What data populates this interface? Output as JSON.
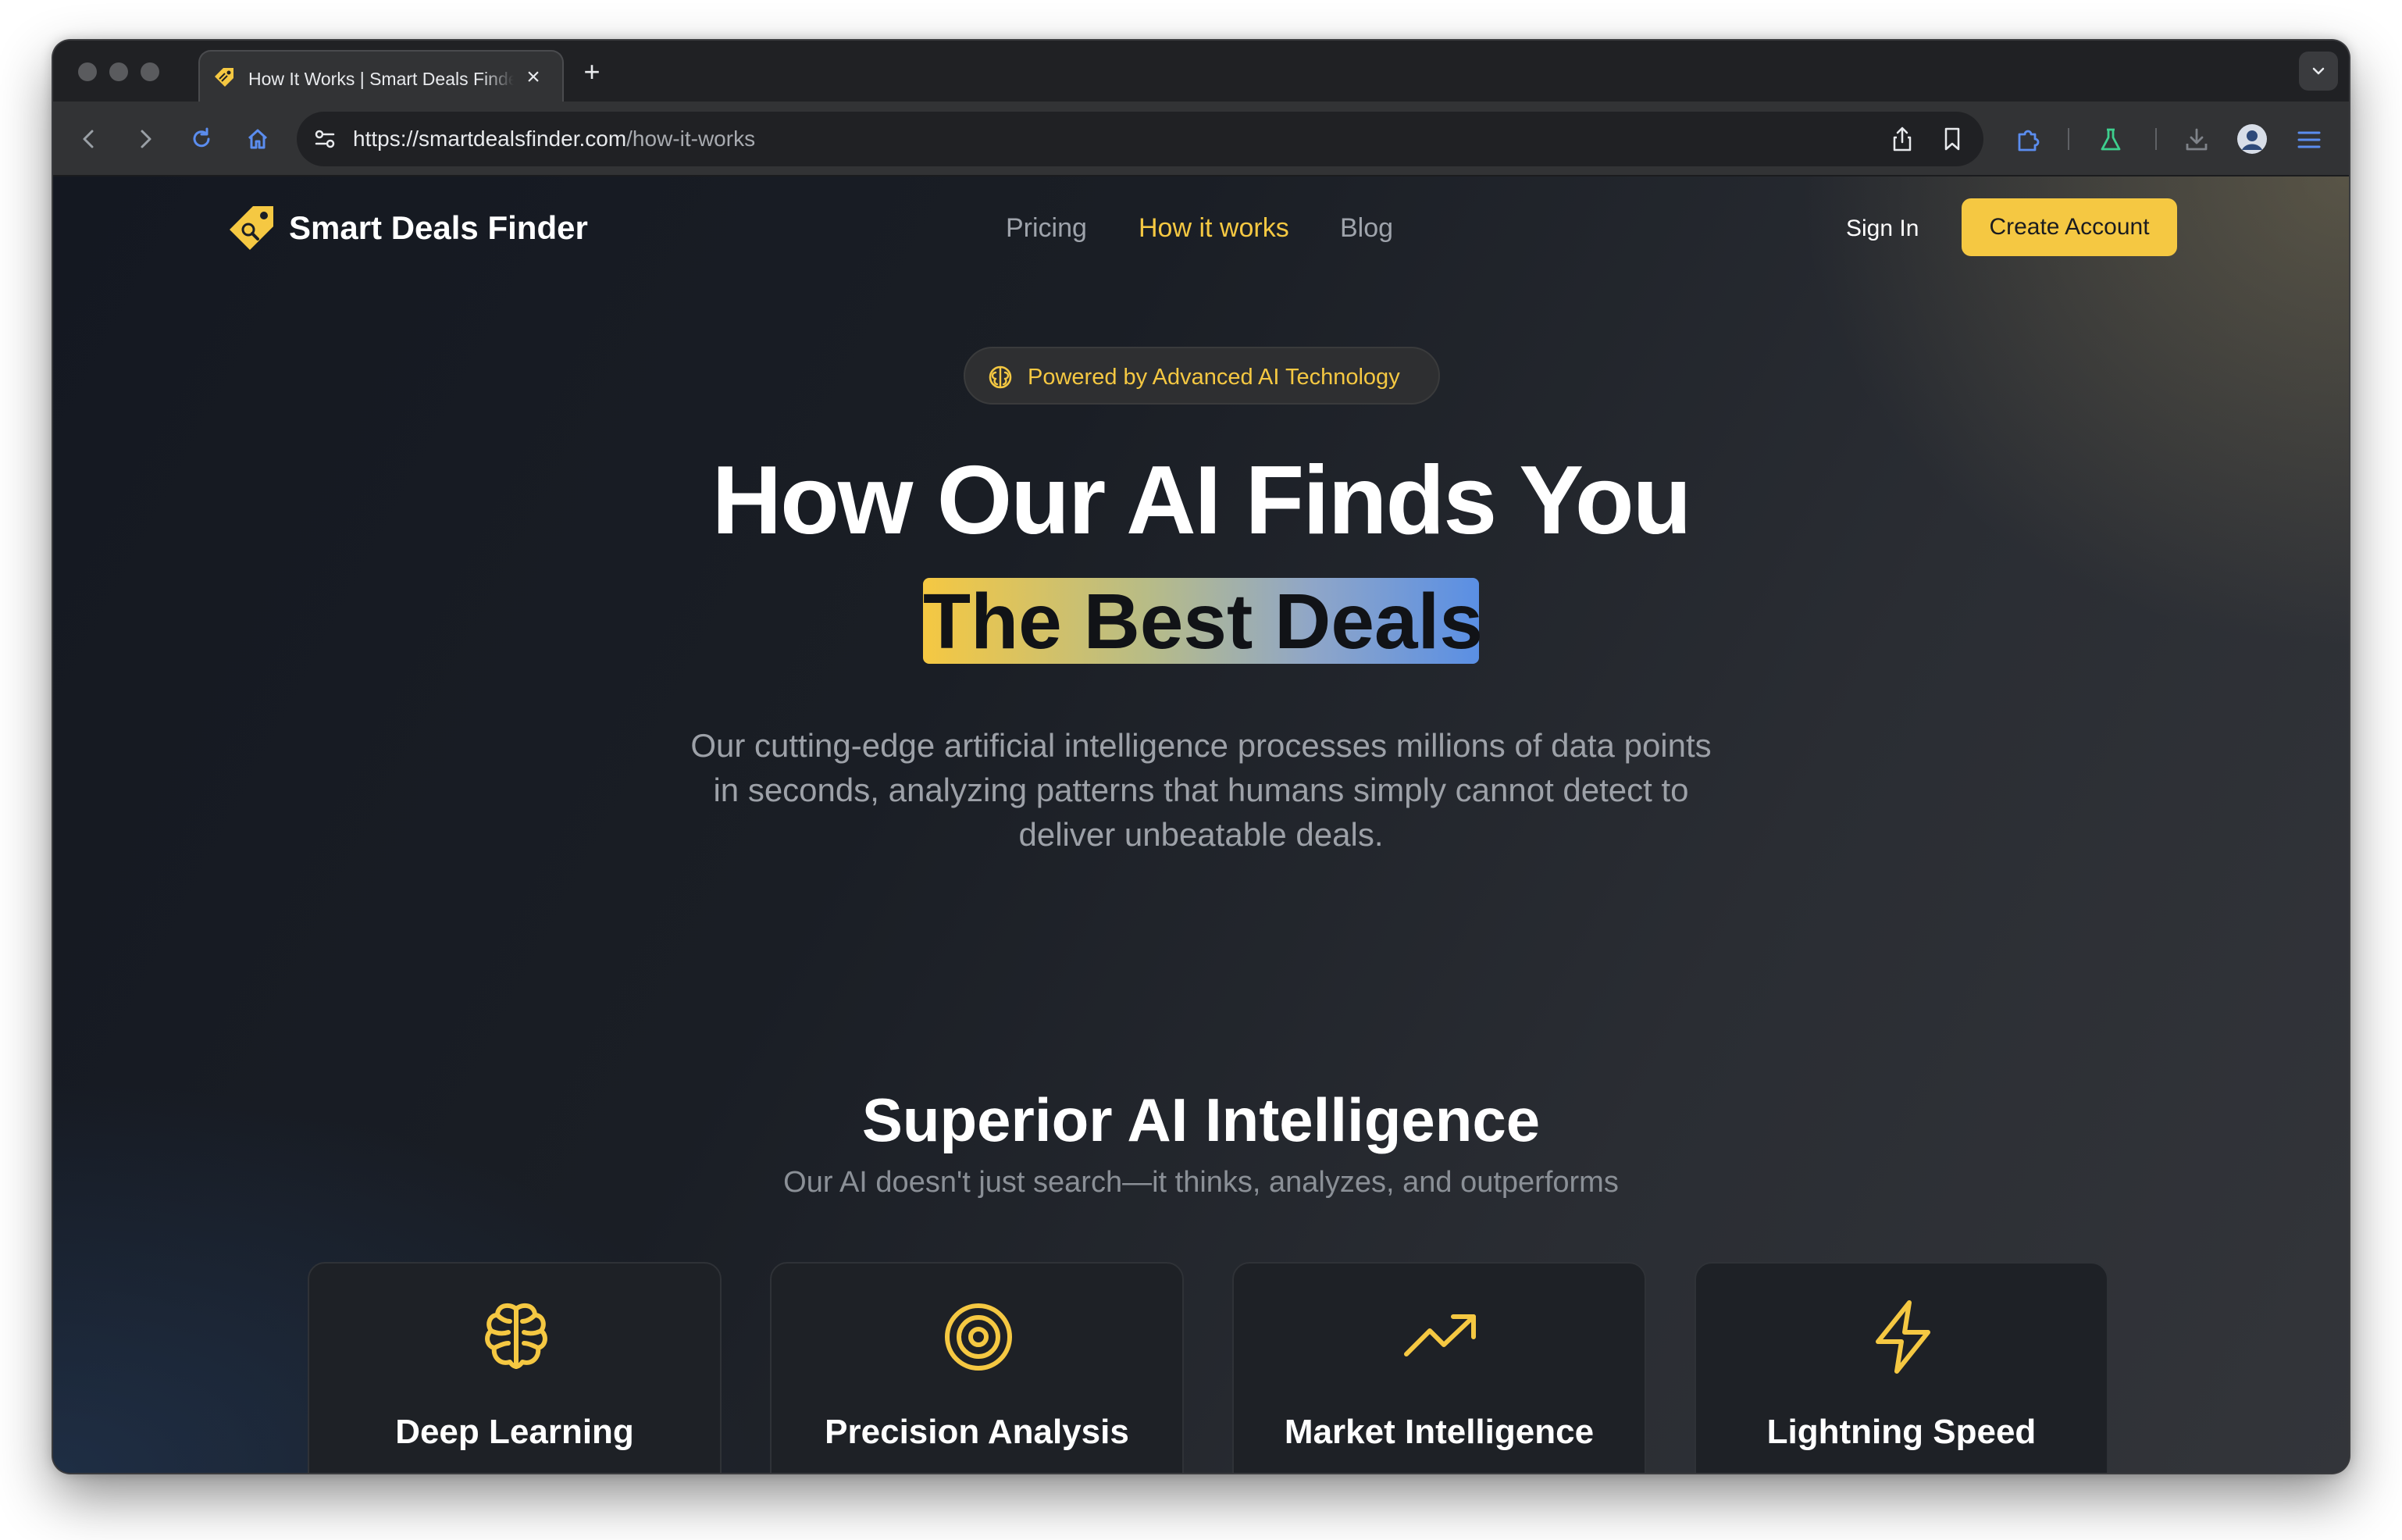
{
  "browser": {
    "tab": {
      "title": "How It Works | Smart Deals Finder"
    },
    "address_bar": {
      "url_host": "https://smartdealsfinder.com",
      "url_path": "/how-it-works"
    },
    "icons": [
      "back-icon",
      "forward-icon",
      "reload-icon",
      "home-icon",
      "site-settings-icon",
      "share-icon",
      "bookmark-icon",
      "extensions-icon",
      "labs-icon",
      "download-icon",
      "profile-avatar",
      "menu-icon"
    ]
  },
  "site": {
    "brand": "Smart Deals Finder",
    "nav": [
      {
        "label": "Pricing",
        "active": false
      },
      {
        "label": "How it works",
        "active": true
      },
      {
        "label": "Blog",
        "active": false
      }
    ],
    "sign_in": "Sign In",
    "create_account": "Create Account"
  },
  "hero": {
    "badge": "Powered by Advanced AI Technology",
    "title_line1": "How Our AI Finds You",
    "title_line2": "The Best Deals",
    "subtitle": "Our cutting-edge artificial intelligence processes millions of data points in seconds, analyzing patterns that humans simply cannot detect to deliver unbeatable deals."
  },
  "features": {
    "title": "Superior AI Intelligence",
    "subtitle": "Our AI doesn't just search—it thinks, analyzes, and outperforms",
    "cards": [
      {
        "title": "Deep Learning",
        "icon": "brain-icon"
      },
      {
        "title": "Precision Analysis",
        "icon": "target-icon"
      },
      {
        "title": "Market Intelligence",
        "icon": "trending-up-icon"
      },
      {
        "title": "Lightning Speed",
        "icon": "lightning-icon"
      }
    ]
  },
  "colors": {
    "accent": "#f5c842",
    "gradient_end": "#5a8fe4",
    "page_background": "#1a1e25",
    "card_background": "#1e2126"
  }
}
